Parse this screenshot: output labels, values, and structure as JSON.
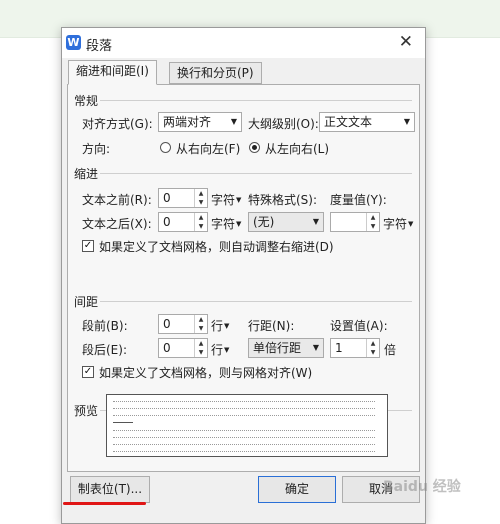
{
  "dialog": {
    "title": "段落",
    "close_glyph": "✕",
    "app_icon_letter": "W"
  },
  "tabs": [
    {
      "label": "缩进和间距(I)",
      "active": true
    },
    {
      "label": "换行和分页(P)",
      "active": false
    }
  ],
  "general": {
    "heading": "常规",
    "alignment_label": "对齐方式(G):",
    "alignment_value": "两端对齐",
    "outline_label": "大纲级别(O):",
    "outline_value": "正文文本",
    "direction_label": "方向:",
    "rtl_label": "从右向左(F)",
    "ltr_label": "从左向右(L)",
    "direction_selected": "ltr"
  },
  "indent": {
    "heading": "缩进",
    "before_label": "文本之前(R):",
    "before_value": "0",
    "before_unit": "字符",
    "special_label": "特殊格式(S):",
    "special_value": "(无)",
    "measure_label": "度量值(Y):",
    "measure_value": "",
    "measure_unit": "字符",
    "after_label": "文本之后(X):",
    "after_value": "0",
    "after_unit": "字符",
    "grid_checkbox_label": "如果定义了文档网格，则自动调整右缩进(D)",
    "grid_checked": true
  },
  "spacing": {
    "heading": "间距",
    "before_label": "段前(B):",
    "before_value": "0",
    "before_unit": "行",
    "after_label": "段后(E):",
    "after_value": "0",
    "after_unit": "行",
    "line_label": "行距(N):",
    "line_value": "单倍行距",
    "setting_label": "设置值(A):",
    "setting_value": "1",
    "setting_unit": "倍",
    "grid_checkbox_label": "如果定义了文档网格，则与网格对齐(W)",
    "grid_checked": true
  },
  "preview": {
    "heading": "预览"
  },
  "buttons": {
    "tabs": "制表位(T)...",
    "ok": "确定",
    "cancel": "取消"
  },
  "watermark": "Baidu 经验",
  "colors": {
    "accent": "#2a6fd6",
    "highlight_underline": "#e01515",
    "top_band": "#eef5ec"
  }
}
